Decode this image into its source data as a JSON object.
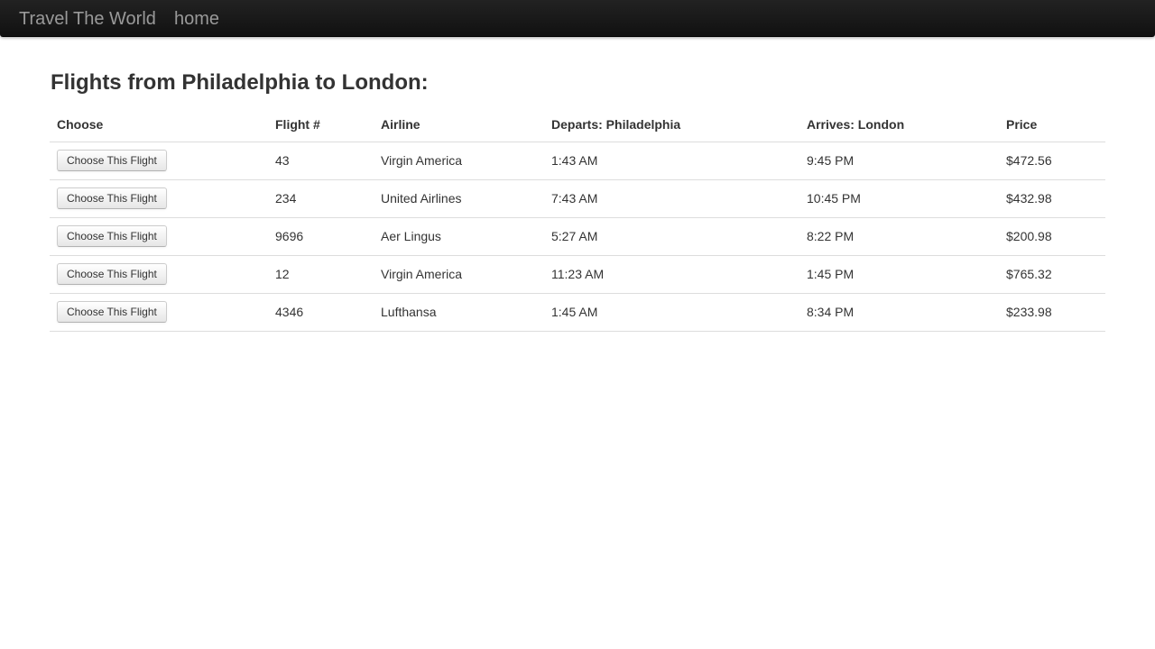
{
  "navbar": {
    "brand": "Travel The World",
    "home_link": "home"
  },
  "page": {
    "title": "Flights from Philadelphia to London:"
  },
  "table": {
    "headers": [
      "Choose",
      "Flight #",
      "Airline",
      "Departs: Philadelphia",
      "Arrives: London",
      "Price"
    ],
    "button_label": "Choose This Flight",
    "rows": [
      {
        "flight": "43",
        "airline": "Virgin America",
        "departs": "1:43 AM",
        "arrives": "9:45 PM",
        "price": "$472.56"
      },
      {
        "flight": "234",
        "airline": "United Airlines",
        "departs": "7:43 AM",
        "arrives": "10:45 PM",
        "price": "$432.98"
      },
      {
        "flight": "9696",
        "airline": "Aer Lingus",
        "departs": "5:27 AM",
        "arrives": "8:22 PM",
        "price": "$200.98"
      },
      {
        "flight": "12",
        "airline": "Virgin America",
        "departs": "11:23 AM",
        "arrives": "1:45 PM",
        "price": "$765.32"
      },
      {
        "flight": "4346",
        "airline": "Lufthansa",
        "departs": "1:45 AM",
        "arrives": "8:34 PM",
        "price": "$233.98"
      }
    ]
  }
}
